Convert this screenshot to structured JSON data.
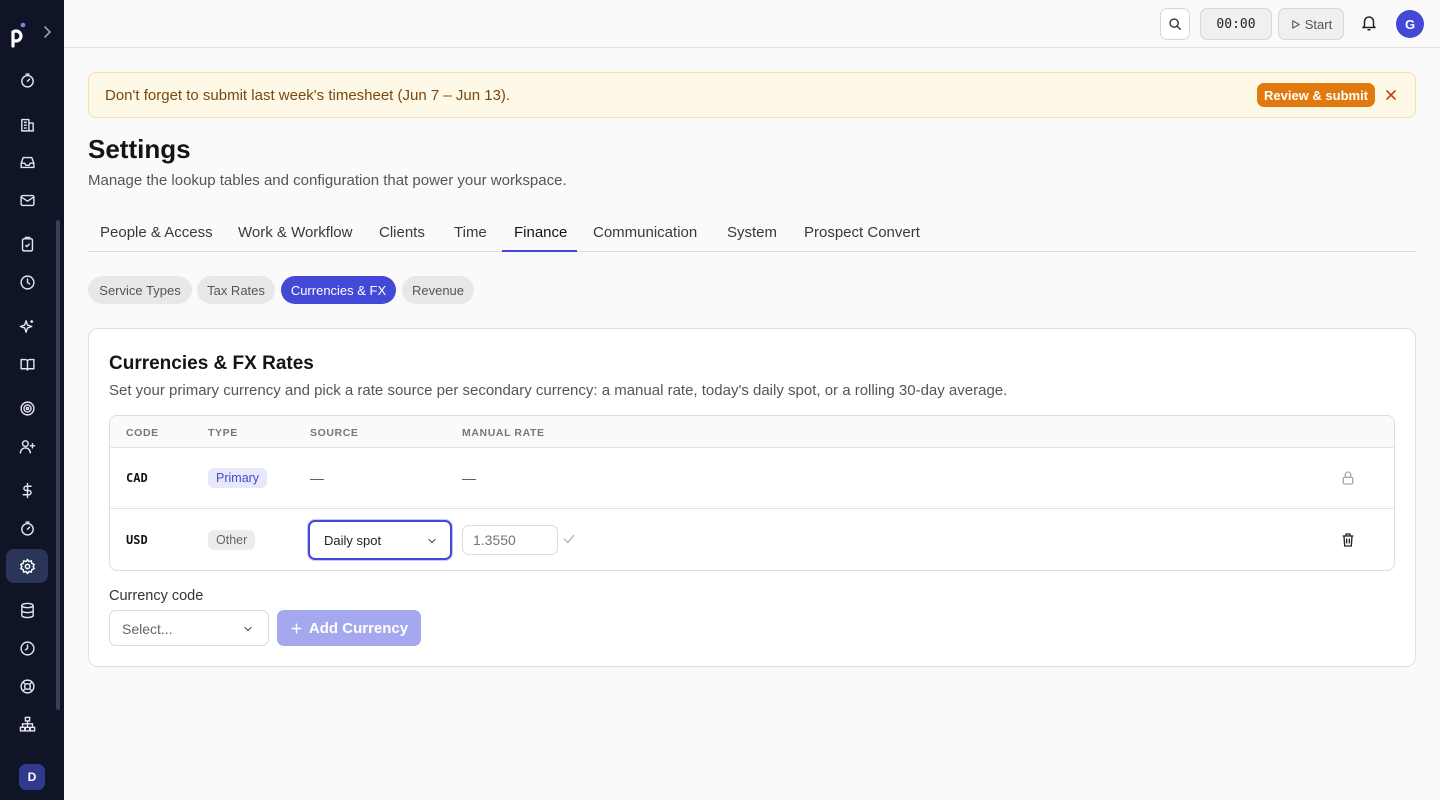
{
  "sidebar": {
    "user_initial": "D",
    "icons": [
      "timer-icon",
      "building-icon",
      "inbox-icon",
      "mail-icon",
      "clipboard-check-icon",
      "clock-icon",
      "sparkles-icon",
      "book-icon",
      "target-icon",
      "user-plus-icon",
      "dollar-icon",
      "timer-icon",
      "gear-icon",
      "database-icon",
      "history-icon",
      "lifebuoy-icon",
      "hierarchy-icon"
    ],
    "active_icon": "gear-icon"
  },
  "topbar": {
    "timer": "00:00",
    "start_label": "Start",
    "avatar_initial": "G"
  },
  "banner": {
    "text": "Don't forget to submit last week's timesheet (Jun 7 – Jun 13).",
    "button_label": "Review & submit"
  },
  "page": {
    "title": "Settings",
    "subtitle": "Manage the lookup tables and configuration that power your workspace."
  },
  "tabs": [
    {
      "label": "People & Access"
    },
    {
      "label": "Work & Workflow"
    },
    {
      "label": "Clients"
    },
    {
      "label": "Time"
    },
    {
      "label": "Finance"
    },
    {
      "label": "Communication"
    },
    {
      "label": "System"
    },
    {
      "label": "Prospect Convert"
    }
  ],
  "active_tab": "Finance",
  "subtabs": [
    {
      "label": "Service Types"
    },
    {
      "label": "Tax Rates"
    },
    {
      "label": "Currencies & FX"
    },
    {
      "label": "Revenue"
    }
  ],
  "active_subtab": "Currencies & FX",
  "card": {
    "title": "Currencies & FX Rates",
    "subtitle": "Set your primary currency and pick a rate source per secondary currency: a manual rate, today's daily spot, or a rolling 30-day average.",
    "columns": [
      "CODE",
      "TYPE",
      "SOURCE",
      "MANUAL RATE"
    ],
    "rows": [
      {
        "code": "CAD",
        "type": "Primary",
        "source": "—",
        "manual_rate": "—"
      },
      {
        "code": "USD",
        "type": "Other",
        "source": "Daily spot",
        "manual_rate_placeholder": "1.3550"
      }
    ],
    "add": {
      "label": "Currency code",
      "placeholder": "Select...",
      "button_label": "Add Currency"
    }
  },
  "colors": {
    "accent": "#4348d6",
    "sidebar_bg": "#0f1426",
    "banner_bg": "#fef9e6",
    "banner_button": "#e2790f"
  }
}
